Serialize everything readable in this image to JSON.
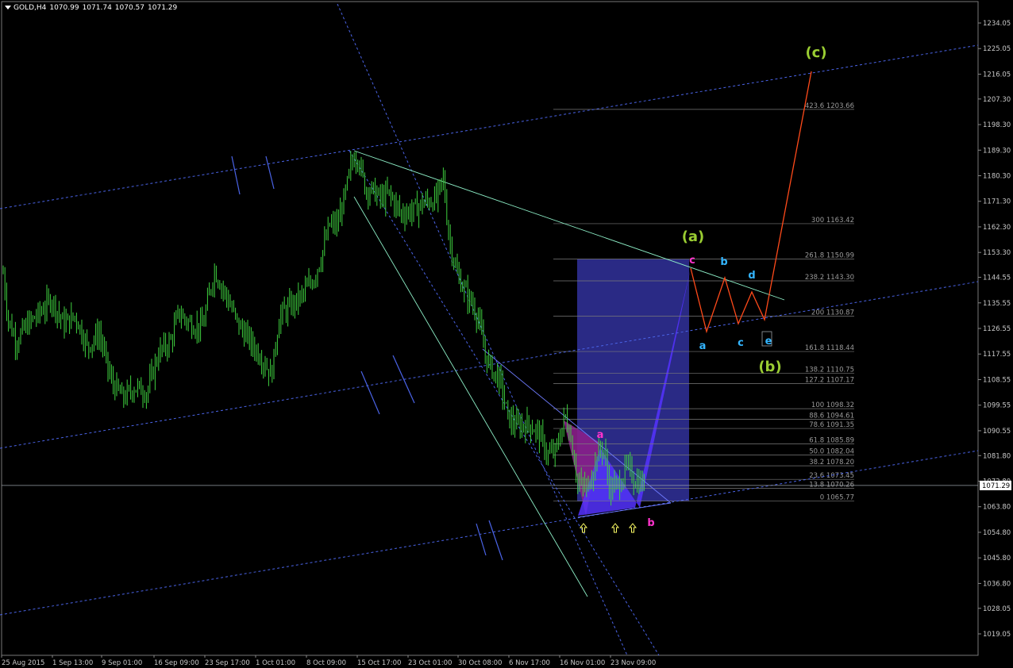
{
  "header": {
    "symbol": "GOLD,H4",
    "open": "1070.99",
    "high": "1071.74",
    "low": "1070.57",
    "close": "1071.29"
  },
  "colors": {
    "background": "#000000",
    "candle": "#3fd13f",
    "price_axis_text": "#c8c8c8",
    "channel": "#4a63e6",
    "wave_path": "#ff4a1a",
    "fib_levels": "#7a7a7a",
    "pattern_fill": "#5533ff",
    "box_fill": "#2c2c8c",
    "trendline": "#8ef0c8",
    "label_pink": "#ff33cc",
    "label_cyan": "#33b5ff",
    "label_olive": "#9acd32",
    "arrow_yellow": "#ffff66"
  },
  "chart_data": {
    "type": "candlestick",
    "symbol": "GOLD",
    "timeframe": "H4",
    "ylim": [
      1019.05,
      1240
    ],
    "price_axis_ticks": [
      "1234.05",
      "1225.05",
      "1216.05",
      "1207.30",
      "1198.30",
      "1189.30",
      "1180.30",
      "1171.30",
      "1162.30",
      "1153.30",
      "1144.55",
      "1135.55",
      "1126.55",
      "1117.55",
      "1108.55",
      "1099.55",
      "1090.55",
      "1081.80",
      "1072.80",
      "1063.80",
      "1054.80",
      "1045.80",
      "1036.80",
      "1028.05",
      "1019.05"
    ],
    "current_price": "1071.29",
    "time_axis_ticks": [
      "25 Aug 2015",
      "1 Sep 13:00",
      "9 Sep 01:00",
      "16 Sep 09:00",
      "23 Sep 17:00",
      "1 Oct 01:00",
      "8 Oct 09:00",
      "15 Oct 17:00",
      "23 Oct 01:00",
      "30 Oct 08:00",
      "6 Nov 17:00",
      "16 Nov 01:00",
      "23 Nov 09:00"
    ],
    "price_path": [
      [
        0,
        1157
      ],
      [
        10,
        1130
      ],
      [
        20,
        1122
      ],
      [
        35,
        1128
      ],
      [
        50,
        1132
      ],
      [
        65,
        1137
      ],
      [
        80,
        1128
      ],
      [
        95,
        1131
      ],
      [
        110,
        1120
      ],
      [
        125,
        1125
      ],
      [
        140,
        1108
      ],
      [
        155,
        1102
      ],
      [
        170,
        1106
      ],
      [
        185,
        1104
      ],
      [
        200,
        1118
      ],
      [
        215,
        1122
      ],
      [
        225,
        1132
      ],
      [
        240,
        1128
      ],
      [
        255,
        1127
      ],
      [
        270,
        1147
      ],
      [
        285,
        1138
      ],
      [
        300,
        1128
      ],
      [
        315,
        1122
      ],
      [
        330,
        1116
      ],
      [
        342,
        1110
      ],
      [
        352,
        1131
      ],
      [
        365,
        1134
      ],
      [
        380,
        1138
      ],
      [
        395,
        1144
      ],
      [
        405,
        1152
      ],
      [
        415,
        1163
      ],
      [
        425,
        1163
      ],
      [
        435,
        1174
      ],
      [
        443,
        1185
      ],
      [
        450,
        1188
      ],
      [
        460,
        1176
      ],
      [
        470,
        1175
      ],
      [
        480,
        1172
      ],
      [
        490,
        1174
      ],
      [
        505,
        1167
      ],
      [
        520,
        1168
      ],
      [
        535,
        1171
      ],
      [
        550,
        1172
      ],
      [
        558,
        1180
      ],
      [
        565,
        1160
      ],
      [
        575,
        1146
      ],
      [
        585,
        1140
      ],
      [
        595,
        1135
      ],
      [
        603,
        1130
      ],
      [
        610,
        1118
      ],
      [
        620,
        1112
      ],
      [
        630,
        1108
      ],
      [
        640,
        1095
      ],
      [
        652,
        1092
      ],
      [
        665,
        1093
      ],
      [
        678,
        1090
      ],
      [
        690,
        1082
      ],
      [
        700,
        1083
      ],
      [
        712,
        1096
      ],
      [
        720,
        1087
      ],
      [
        728,
        1072
      ],
      [
        740,
        1070
      ],
      [
        752,
        1082
      ],
      [
        760,
        1085
      ],
      [
        768,
        1070
      ],
      [
        780,
        1072
      ],
      [
        790,
        1078
      ],
      [
        800,
        1073
      ],
      [
        810,
        1072
      ]
    ],
    "fibonacci": [
      {
        "level": "0",
        "price": "1065.77"
      },
      {
        "level": "13.8",
        "price": "1070.26"
      },
      {
        "level": "23.6",
        "price": "1073.45"
      },
      {
        "level": "38.2",
        "price": "1078.20"
      },
      {
        "level": "50.0",
        "price": "1082.04"
      },
      {
        "level": "61.8",
        "price": "1085.89"
      },
      {
        "level": "78.6",
        "price": "1091.35"
      },
      {
        "level": "88.6",
        "price": "1094.61"
      },
      {
        "level": "100",
        "price": "1098.32"
      },
      {
        "level": "127.2",
        "price": "1107.17"
      },
      {
        "level": "138.2",
        "price": "1110.75"
      },
      {
        "level": "161.8",
        "price": "1118.44"
      },
      {
        "level": "200",
        "price": "1130.87"
      },
      {
        "level": "238.2",
        "price": "1143.30"
      },
      {
        "level": "261.8",
        "price": "1150.99"
      },
      {
        "level": "300",
        "price": "1163.42"
      },
      {
        "level": "423.6",
        "price": "1203.66"
      }
    ],
    "wave_labels": [
      {
        "text": "(a)",
        "color": "olive"
      },
      {
        "text": "(b)",
        "color": "olive"
      },
      {
        "text": "(c)",
        "color": "olive"
      },
      {
        "text": "a",
        "color": "pink"
      },
      {
        "text": "b",
        "color": "pink"
      },
      {
        "text": "c",
        "color": "pink"
      },
      {
        "text": "a",
        "color": "cyan"
      },
      {
        "text": "b",
        "color": "cyan"
      },
      {
        "text": "c",
        "color": "cyan"
      },
      {
        "text": "d",
        "color": "cyan"
      },
      {
        "text": "e",
        "color": "cyan"
      }
    ]
  }
}
